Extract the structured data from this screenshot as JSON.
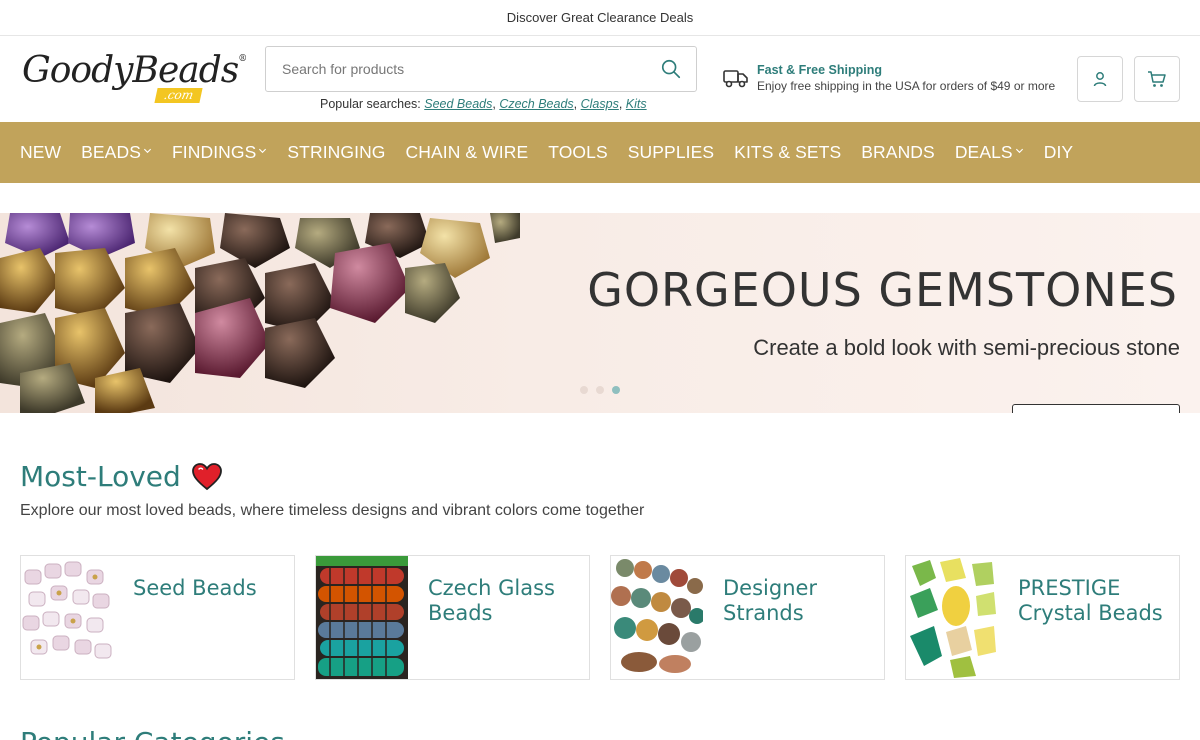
{
  "topbar": {
    "promo": "Discover Great Clearance Deals"
  },
  "header": {
    "logo_text": "GoodyBeads",
    "logo_tm": "®",
    "logo_sub": ".com",
    "search_placeholder": "Search for products",
    "popular_label": "Popular searches:",
    "popular_searches": [
      "Seed Beads",
      "Czech Beads",
      "Clasps",
      "Kits"
    ],
    "shipping_title": "Fast & Free Shipping",
    "shipping_desc": "Enjoy free shipping in the USA for orders of $49 or more"
  },
  "nav": {
    "items": [
      {
        "label": "NEW",
        "dropdown": false
      },
      {
        "label": "BEADS",
        "dropdown": true
      },
      {
        "label": "FINDINGS",
        "dropdown": true
      },
      {
        "label": "STRINGING",
        "dropdown": false
      },
      {
        "label": "CHAIN & WIRE",
        "dropdown": false
      },
      {
        "label": "TOOLS",
        "dropdown": false
      },
      {
        "label": "SUPPLIES",
        "dropdown": false
      },
      {
        "label": "KITS & SETS",
        "dropdown": false
      },
      {
        "label": "BRANDS",
        "dropdown": false
      },
      {
        "label": "DEALS",
        "dropdown": true
      },
      {
        "label": "DIY",
        "dropdown": false
      }
    ]
  },
  "hero": {
    "title": "GORGEOUS GEMSTONES",
    "subtitle": "Create a bold look with semi-precious stone",
    "slide_count": 3,
    "active_slide": 3
  },
  "most_loved": {
    "title": "Most-Loved",
    "description": "Explore our most loved beads, where timeless designs and vibrant colors come together",
    "cards": [
      {
        "label": "Seed Beads"
      },
      {
        "label": "Czech Glass Beads"
      },
      {
        "label": "Designer Strands"
      },
      {
        "label": "PRESTIGE Crystal Beads"
      }
    ]
  },
  "next_section": {
    "title": "Popular Categories"
  },
  "colors": {
    "accent": "#2e7d7a",
    "nav_bg": "#c1a35b",
    "logo_yellow": "#f3c622"
  }
}
